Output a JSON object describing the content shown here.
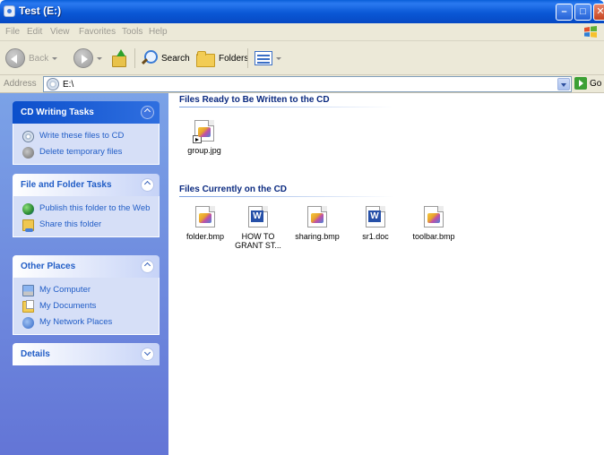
{
  "window": {
    "title": "Test (E:)"
  },
  "menu": [
    "File",
    "Edit",
    "View",
    "Favorites",
    "Tools",
    "Help"
  ],
  "toolbar": {
    "back": "Back",
    "search": "Search",
    "folders": "Folders"
  },
  "address": {
    "label": "Address",
    "value": "E:\\",
    "go": "Go"
  },
  "panels": {
    "cd_writing": {
      "title": "CD Writing Tasks",
      "items": [
        "Write these files to CD",
        "Delete temporary files"
      ]
    },
    "file_folder": {
      "title": "File and Folder Tasks",
      "items": [
        "Publish this folder to the Web",
        "Share this folder"
      ]
    },
    "other_places": {
      "title": "Other Places",
      "items": [
        "My Computer",
        "My Documents",
        "My Network Places"
      ]
    },
    "details": {
      "title": "Details"
    }
  },
  "groups": {
    "ready": {
      "title": "Files Ready to Be Written to the CD",
      "files": [
        {
          "name": "group.jpg",
          "icon": "image-icon"
        }
      ]
    },
    "current": {
      "title": "Files Currently on the CD",
      "files": [
        {
          "name": "folder.bmp",
          "icon": "bitmap-icon"
        },
        {
          "name": "HOW TO GRANT ST...",
          "icon": "word-document-icon"
        },
        {
          "name": "sharing.bmp",
          "icon": "bitmap-icon"
        },
        {
          "name": "sr1.doc",
          "icon": "word-document-icon"
        },
        {
          "name": "toolbar.bmp",
          "icon": "bitmap-icon"
        }
      ]
    }
  }
}
